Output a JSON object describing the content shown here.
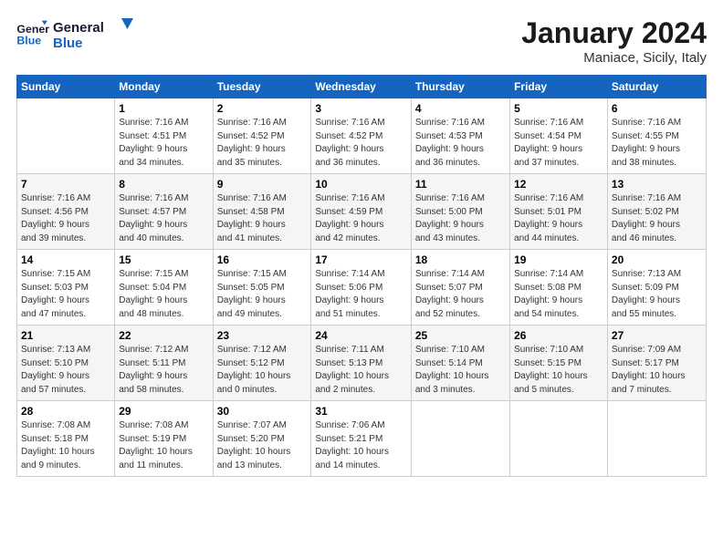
{
  "header": {
    "logo_line1": "General",
    "logo_line2": "Blue",
    "month": "January 2024",
    "location": "Maniace, Sicily, Italy"
  },
  "days_of_week": [
    "Sunday",
    "Monday",
    "Tuesday",
    "Wednesday",
    "Thursday",
    "Friday",
    "Saturday"
  ],
  "weeks": [
    [
      {
        "day": "",
        "info": ""
      },
      {
        "day": "1",
        "info": "Sunrise: 7:16 AM\nSunset: 4:51 PM\nDaylight: 9 hours\nand 34 minutes."
      },
      {
        "day": "2",
        "info": "Sunrise: 7:16 AM\nSunset: 4:52 PM\nDaylight: 9 hours\nand 35 minutes."
      },
      {
        "day": "3",
        "info": "Sunrise: 7:16 AM\nSunset: 4:52 PM\nDaylight: 9 hours\nand 36 minutes."
      },
      {
        "day": "4",
        "info": "Sunrise: 7:16 AM\nSunset: 4:53 PM\nDaylight: 9 hours\nand 36 minutes."
      },
      {
        "day": "5",
        "info": "Sunrise: 7:16 AM\nSunset: 4:54 PM\nDaylight: 9 hours\nand 37 minutes."
      },
      {
        "day": "6",
        "info": "Sunrise: 7:16 AM\nSunset: 4:55 PM\nDaylight: 9 hours\nand 38 minutes."
      }
    ],
    [
      {
        "day": "7",
        "info": "Sunrise: 7:16 AM\nSunset: 4:56 PM\nDaylight: 9 hours\nand 39 minutes."
      },
      {
        "day": "8",
        "info": "Sunrise: 7:16 AM\nSunset: 4:57 PM\nDaylight: 9 hours\nand 40 minutes."
      },
      {
        "day": "9",
        "info": "Sunrise: 7:16 AM\nSunset: 4:58 PM\nDaylight: 9 hours\nand 41 minutes."
      },
      {
        "day": "10",
        "info": "Sunrise: 7:16 AM\nSunset: 4:59 PM\nDaylight: 9 hours\nand 42 minutes."
      },
      {
        "day": "11",
        "info": "Sunrise: 7:16 AM\nSunset: 5:00 PM\nDaylight: 9 hours\nand 43 minutes."
      },
      {
        "day": "12",
        "info": "Sunrise: 7:16 AM\nSunset: 5:01 PM\nDaylight: 9 hours\nand 44 minutes."
      },
      {
        "day": "13",
        "info": "Sunrise: 7:16 AM\nSunset: 5:02 PM\nDaylight: 9 hours\nand 46 minutes."
      }
    ],
    [
      {
        "day": "14",
        "info": "Sunrise: 7:15 AM\nSunset: 5:03 PM\nDaylight: 9 hours\nand 47 minutes."
      },
      {
        "day": "15",
        "info": "Sunrise: 7:15 AM\nSunset: 5:04 PM\nDaylight: 9 hours\nand 48 minutes."
      },
      {
        "day": "16",
        "info": "Sunrise: 7:15 AM\nSunset: 5:05 PM\nDaylight: 9 hours\nand 49 minutes."
      },
      {
        "day": "17",
        "info": "Sunrise: 7:14 AM\nSunset: 5:06 PM\nDaylight: 9 hours\nand 51 minutes."
      },
      {
        "day": "18",
        "info": "Sunrise: 7:14 AM\nSunset: 5:07 PM\nDaylight: 9 hours\nand 52 minutes."
      },
      {
        "day": "19",
        "info": "Sunrise: 7:14 AM\nSunset: 5:08 PM\nDaylight: 9 hours\nand 54 minutes."
      },
      {
        "day": "20",
        "info": "Sunrise: 7:13 AM\nSunset: 5:09 PM\nDaylight: 9 hours\nand 55 minutes."
      }
    ],
    [
      {
        "day": "21",
        "info": "Sunrise: 7:13 AM\nSunset: 5:10 PM\nDaylight: 9 hours\nand 57 minutes."
      },
      {
        "day": "22",
        "info": "Sunrise: 7:12 AM\nSunset: 5:11 PM\nDaylight: 9 hours\nand 58 minutes."
      },
      {
        "day": "23",
        "info": "Sunrise: 7:12 AM\nSunset: 5:12 PM\nDaylight: 10 hours\nand 0 minutes."
      },
      {
        "day": "24",
        "info": "Sunrise: 7:11 AM\nSunset: 5:13 PM\nDaylight: 10 hours\nand 2 minutes."
      },
      {
        "day": "25",
        "info": "Sunrise: 7:10 AM\nSunset: 5:14 PM\nDaylight: 10 hours\nand 3 minutes."
      },
      {
        "day": "26",
        "info": "Sunrise: 7:10 AM\nSunset: 5:15 PM\nDaylight: 10 hours\nand 5 minutes."
      },
      {
        "day": "27",
        "info": "Sunrise: 7:09 AM\nSunset: 5:17 PM\nDaylight: 10 hours\nand 7 minutes."
      }
    ],
    [
      {
        "day": "28",
        "info": "Sunrise: 7:08 AM\nSunset: 5:18 PM\nDaylight: 10 hours\nand 9 minutes."
      },
      {
        "day": "29",
        "info": "Sunrise: 7:08 AM\nSunset: 5:19 PM\nDaylight: 10 hours\nand 11 minutes."
      },
      {
        "day": "30",
        "info": "Sunrise: 7:07 AM\nSunset: 5:20 PM\nDaylight: 10 hours\nand 13 minutes."
      },
      {
        "day": "31",
        "info": "Sunrise: 7:06 AM\nSunset: 5:21 PM\nDaylight: 10 hours\nand 14 minutes."
      },
      {
        "day": "",
        "info": ""
      },
      {
        "day": "",
        "info": ""
      },
      {
        "day": "",
        "info": ""
      }
    ]
  ]
}
